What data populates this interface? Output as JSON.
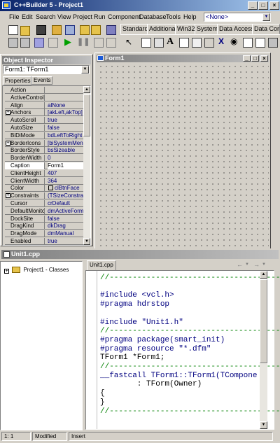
{
  "title": "C++Builder 5 - Project1",
  "window_controls": {
    "minimize": "_",
    "maximize": "□",
    "close": "×"
  },
  "menu": [
    "File",
    "Edit",
    "Search",
    "View",
    "Project",
    "Run",
    "Component",
    "Database",
    "Tools",
    "Help"
  ],
  "config_combo": "<None>",
  "palette_tabs": [
    "Standard",
    "Additional",
    "Win32",
    "System",
    "Data Access",
    "Data Contro"
  ],
  "object_inspector": {
    "title": "Object Inspector",
    "selector": "Form1: TForm1",
    "tabs": [
      "Properties",
      "Events"
    ],
    "properties": [
      {
        "name": "Action",
        "value": "",
        "expand": false
      },
      {
        "name": "ActiveControl",
        "value": "",
        "expand": false
      },
      {
        "name": "Align",
        "value": "alNone",
        "expand": false
      },
      {
        "name": "Anchors",
        "value": "[akLeft,akTop]",
        "expand": true
      },
      {
        "name": "AutoScroll",
        "value": "true",
        "expand": false
      },
      {
        "name": "AutoSize",
        "value": "false",
        "expand": false
      },
      {
        "name": "BiDiMode",
        "value": "bdLeftToRight",
        "expand": false
      },
      {
        "name": "BorderIcons",
        "value": "[biSystemMenu,b",
        "expand": true
      },
      {
        "name": "BorderStyle",
        "value": "bsSizeable",
        "expand": false
      },
      {
        "name": "BorderWidth",
        "value": "0",
        "expand": false
      },
      {
        "name": "Caption",
        "value": "Form1",
        "expand": false
      },
      {
        "name": "ClientHeight",
        "value": "407",
        "expand": false
      },
      {
        "name": "ClientWidth",
        "value": "364",
        "expand": false
      },
      {
        "name": "Color",
        "value": "clBtnFace",
        "expand": false
      },
      {
        "name": "Constraints",
        "value": "(TSizeConstraint",
        "expand": true
      },
      {
        "name": "Cursor",
        "value": "crDefault",
        "expand": false
      },
      {
        "name": "DefaultMonitor",
        "value": "dmActiveForm",
        "expand": false
      },
      {
        "name": "DockSite",
        "value": "false",
        "expand": false
      },
      {
        "name": "DragKind",
        "value": "dkDrag",
        "expand": false
      },
      {
        "name": "DragMode",
        "value": "dmManual",
        "expand": false
      },
      {
        "name": "Enabled",
        "value": "true",
        "expand": false
      }
    ]
  },
  "form_designer": {
    "title": "Form1"
  },
  "editor_window": {
    "title": "Unit1.cpp",
    "tab": "Unit1.cpp"
  },
  "class_tree": {
    "root": "Project1 - Classes"
  },
  "code_lines": [
    {
      "text": "//---------------------------------------",
      "style": "g"
    },
    {
      "text": "",
      "style": ""
    },
    {
      "text": "#include <vcl.h>",
      "style": "b"
    },
    {
      "text": "#pragma hdrstop",
      "style": "b"
    },
    {
      "text": "",
      "style": ""
    },
    {
      "text": "#include \"Unit1.h\"",
      "style": "b"
    },
    {
      "text": "//---------------------------------------",
      "style": "g"
    },
    {
      "text": "#pragma package(smart_init)",
      "style": "b"
    },
    {
      "text": "#pragma resource \"*.dfm\"",
      "style": "b"
    },
    {
      "text": "TForm1 *Form1;",
      "style": ""
    },
    {
      "text": "//---------------------------------------",
      "style": "g"
    },
    {
      "text": "__fastcall TForm1::TForm1(TCompone",
      "style": "b"
    },
    {
      "text": "        : TForm(Owner)",
      "style": ""
    },
    {
      "text": "{",
      "style": ""
    },
    {
      "text": "}",
      "style": ""
    },
    {
      "text": "//---------------------------------------",
      "style": "g"
    }
  ],
  "status_bar": {
    "position": "1:   1",
    "state": "Modified",
    "mode": "Insert"
  },
  "colors": {
    "title_start": "#0a246a",
    "title_end": "#a6caf0",
    "panel": "#d4d0c8",
    "code_keyword": "#000080",
    "code_comment": "#008000"
  }
}
